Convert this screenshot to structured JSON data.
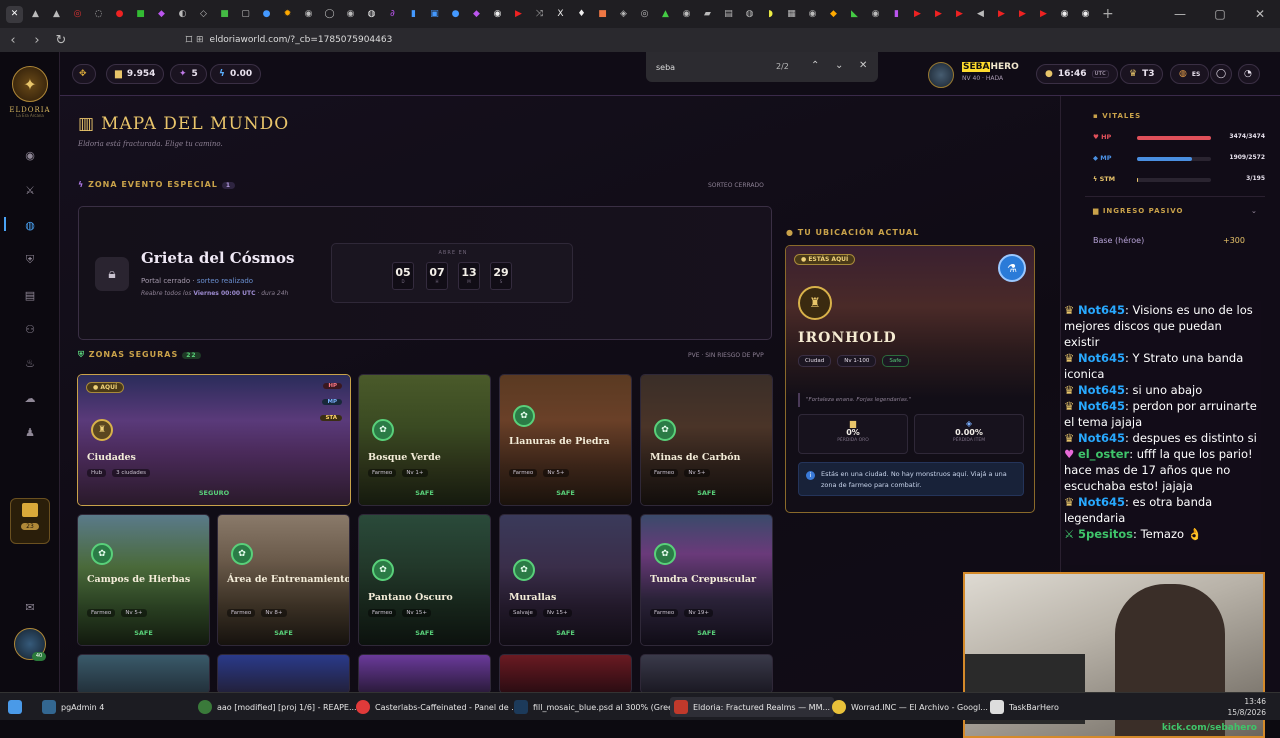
{
  "browser": {
    "url": "eldoriaworld.com/?_cb=1785075904463",
    "find": {
      "query": "seba",
      "count": "2/2"
    }
  },
  "app": {
    "logo_text": "ELDORIA",
    "logo_sub": "La Era Arcana",
    "currency": {
      "gold": "9.954",
      "gems": "5",
      "energy": "0.00"
    },
    "user": {
      "name_highlight": "SEBA",
      "name_rest": "HERO",
      "level": "NV 40 · HADA",
      "avatar_badge": "40"
    },
    "time": "16:46",
    "time_zone": "UTC",
    "tier": "T3",
    "lang": "ES",
    "quest_badge": "23"
  },
  "map": {
    "title": "MAPA DEL MUNDO",
    "subtitle": "Eldoria está fracturada. Elige tu camino.",
    "event_section": {
      "label": "ZONA EVENTO ESPECIAL",
      "count": "1",
      "right": "SORTEO CERRADO"
    },
    "event": {
      "title": "Grieta del Cósmos",
      "status_a": "Portal cerrado · ",
      "status_b": "sorteo realizado",
      "note_a": "Reabre todos los ",
      "note_b": "Viernes 00:00 UTC",
      "note_c": " · dura 24h",
      "timer_label": "ABRE EN",
      "timer": [
        {
          "n": "05",
          "u": "D"
        },
        {
          "n": "07",
          "u": "H"
        },
        {
          "n": "13",
          "u": "M"
        },
        {
          "n": "29",
          "u": "S"
        }
      ]
    },
    "safe_section": {
      "label": "ZONAS SEGURAS",
      "count": "22",
      "right": "PVE · SIN RIESGO DE PVP"
    },
    "zones": [
      {
        "title": "Ciudades",
        "meta1": "Hub",
        "meta2": "3 ciudades",
        "safe": "SEGURO",
        "here": "AQUÍ",
        "tags": [
          "HP",
          "MP",
          "STA"
        ]
      },
      {
        "title": "Bosque Verde",
        "meta1": "Farmeo",
        "meta2": "Nv 1+",
        "safe": "SAFE"
      },
      {
        "title": "Llanuras de Piedra",
        "meta1": "Farmeo",
        "meta2": "Nv 5+",
        "safe": "SAFE"
      },
      {
        "title": "Minas de Carbón",
        "meta1": "Farmeo",
        "meta2": "Nv 5+",
        "safe": "SAFE"
      },
      {
        "title": "Campos de Hierbas",
        "meta1": "Farmeo",
        "meta2": "Nv 5+",
        "safe": "SAFE"
      },
      {
        "title": "Área de Entrenamiento",
        "meta1": "Farmeo",
        "meta2": "Nv 8+",
        "safe": "SAFE"
      },
      {
        "title": "Pantano Oscuro",
        "meta1": "Farmeo",
        "meta2": "Nv 15+",
        "safe": "SAFE"
      },
      {
        "title": "Murallas",
        "meta1": "Salvaje",
        "meta2": "Nv 15+",
        "safe": "SAFE"
      },
      {
        "title": "Tundra Crepuscular",
        "meta1": "Farmeo",
        "meta2": "Nv 19+",
        "safe": "SAFE"
      }
    ]
  },
  "location": {
    "label": "TU UBICACIÓN ACTUAL",
    "badge": "ESTÁS AQUÍ",
    "name": "IRONHOLD",
    "tags": [
      "Ciudad",
      "Nv 1-100",
      "Safe"
    ],
    "quote": "\"Fortaleza enana. Forjas legendarias.\"",
    "stats": [
      {
        "value": "0%",
        "label": "PÉRDIDA ORO"
      },
      {
        "value": "0.00%",
        "label": "PÉRDIDA ITEM"
      }
    ],
    "info": "Estás en una ciudad. No hay monstruos aquí. Viajá a una zona de farmeo para combatir."
  },
  "vitals": {
    "label": "VITALES",
    "rows": [
      {
        "name": "HP",
        "value": "3474/3474",
        "fill": 1.0,
        "color": "#e0505a"
      },
      {
        "name": "MP",
        "value": "1909/2572",
        "fill": 0.74,
        "color": "#4a8fe0"
      },
      {
        "name": "STM",
        "value": "3/195",
        "fill": 0.015,
        "color": "#e9c56b"
      }
    ],
    "income_label": "INGRESO PASIVO",
    "income_row": "Base (héroe)",
    "income_value": "+300"
  },
  "chat": [
    {
      "user": "Not645",
      "text": ": Visions es uno de los mejores discos que puedan existir",
      "color": "u"
    },
    {
      "user": "Not645",
      "text": ": Y Strato una banda iconica",
      "color": "u"
    },
    {
      "user": "Not645",
      "text": ": si uno abajo",
      "color": "u"
    },
    {
      "user": "Not645",
      "text": ": perdon por arruinarte el tema jajaja",
      "color": "u"
    },
    {
      "user": "Not645",
      "text": ": despues es distinto si",
      "color": "u"
    },
    {
      "user": "el_oster",
      "text": ": ufff la que los pario! hace mas de 17 años que no escuchaba esto! jajaja",
      "color": "g"
    },
    {
      "user": "Not645",
      "text": ": es otra banda legendaria",
      "color": "u"
    },
    {
      "user": "5pesitos",
      "text": ": Temazo 👌",
      "color": "g"
    }
  ],
  "cam_link": "kick.com/sebahero",
  "taskbar": {
    "items": [
      "pgAdmin 4",
      "aao [modified] [proj 1/6] - REAPE...",
      "Casterlabs-Caffeinated - Panel de ...",
      "fill_mosaic_blue.psd al 300% (Gree...",
      "Eldoria: Fractured Realms — MM...",
      "Worrad.INC — El Archivo - Googl...",
      "TaskBarHero"
    ],
    "time": "13:46",
    "date": "15/8/2026"
  }
}
